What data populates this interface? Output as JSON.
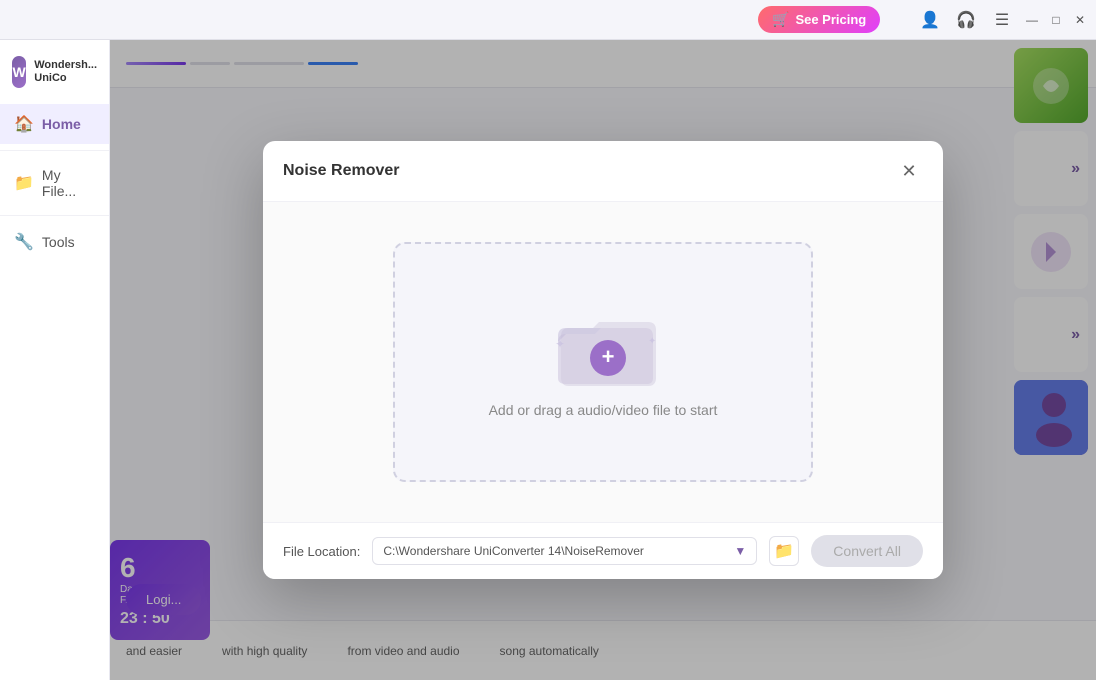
{
  "titleBar": {
    "seePricing": "See Pricing",
    "cartIcon": "🛒",
    "userIcon": "👤",
    "headphoneIcon": "🎧",
    "menuIcon": "☰",
    "minimizeIcon": "—",
    "maximizeIcon": "□",
    "closeIcon": "✕"
  },
  "sidebar": {
    "logoText1": "Wondersh...",
    "logoText2": "UniCo",
    "items": [
      {
        "label": "Home",
        "icon": "🏠",
        "active": true
      },
      {
        "label": "My File...",
        "icon": "📁",
        "active": false
      },
      {
        "label": "Tools",
        "icon": "🔧",
        "active": false
      }
    ]
  },
  "modal": {
    "title": "Noise Remover",
    "closeLabel": "✕",
    "uploadText": "Add or drag a audio/video file to start",
    "addIcon": "+",
    "footer": {
      "fileLocationLabel": "File Location:",
      "filePath": "C:\\Wondershare UniConverter 14\\NoiseRemover",
      "dropdownArrow": "▼",
      "folderIcon": "📁",
      "convertAllLabel": "Convert All"
    }
  },
  "bottomBar": {
    "items": [
      {
        "text": "and easier"
      },
      {
        "text": "with high quality"
      },
      {
        "text": "from video and audio"
      },
      {
        "text": "song automatically"
      }
    ]
  },
  "promo": {
    "day": "6",
    "dayLabel": "Da...",
    "subLabel": "F...",
    "timer": "23 : 50",
    "loginLabel": "Logi..."
  }
}
